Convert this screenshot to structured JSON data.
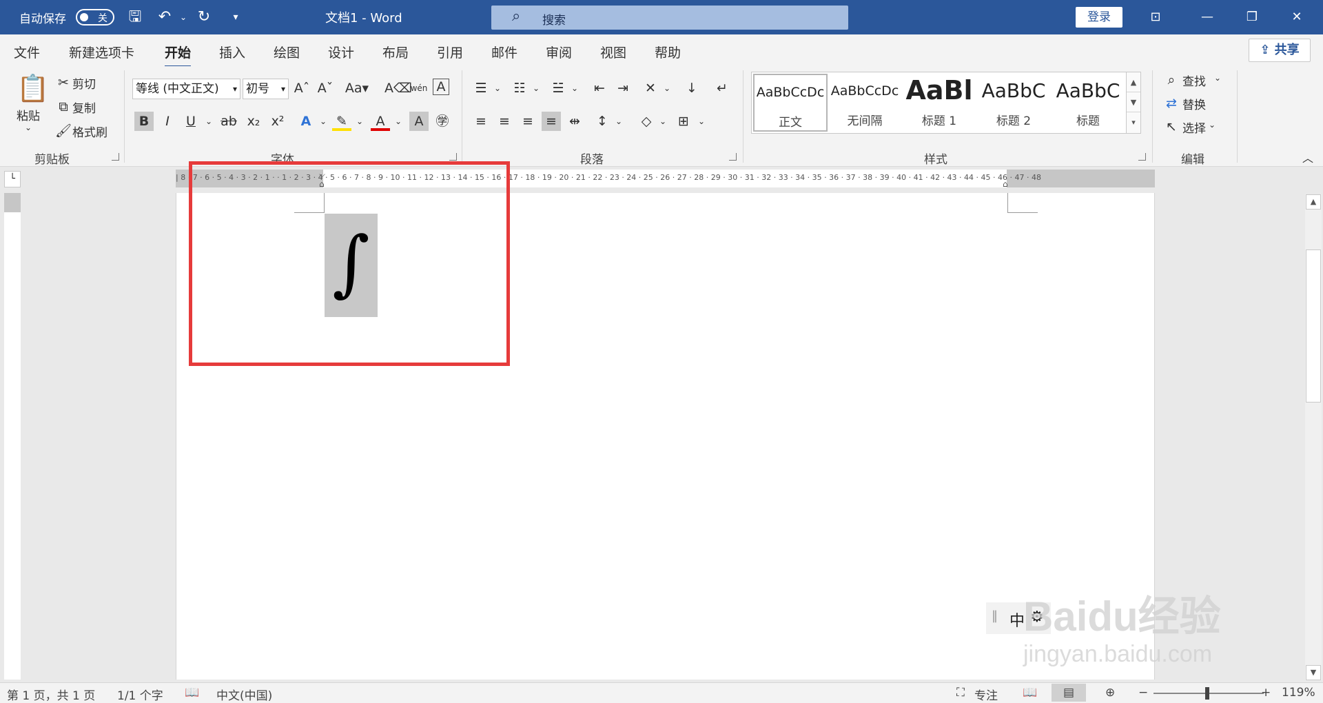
{
  "titlebar": {
    "autosave_label": "自动保存",
    "autosave_state": "关",
    "doc_title": "文档1  -  Word",
    "search_placeholder": "搜索",
    "login_label": "登录"
  },
  "menu": {
    "tabs": [
      "文件",
      "新建选项卡",
      "开始",
      "插入",
      "绘图",
      "设计",
      "布局",
      "引用",
      "邮件",
      "审阅",
      "视图",
      "帮助"
    ],
    "active_tab": "开始",
    "share_label": "共享"
  },
  "ribbon": {
    "clipboard": {
      "paste": "粘贴",
      "cut": "剪切",
      "copy": "复制",
      "format_painter": "格式刷",
      "group_label": "剪贴板"
    },
    "font": {
      "font_name": "等线 (中文正文)",
      "font_size": "初号",
      "group_label": "字体"
    },
    "paragraph": {
      "group_label": "段落"
    },
    "styles": {
      "items": [
        {
          "sample": "AaBbCcDc",
          "name": "正文"
        },
        {
          "sample": "AaBbCcDc",
          "name": "无间隔"
        },
        {
          "sample": "AaBl",
          "name": "标题 1"
        },
        {
          "sample": "AaBbC",
          "name": "标题 2"
        },
        {
          "sample": "AaBbC",
          "name": "标题"
        }
      ],
      "group_label": "样式"
    },
    "editing": {
      "find": "查找",
      "replace": "替换",
      "select": "选择",
      "group_label": "编辑"
    }
  },
  "ruler": {
    "marks": "| 8 · 7 · 6 · 5 · 4 · 3 · 2 · 1 ·   · 1 · 2 · 3 · 4 · 5 · 6 · 7 · 8 · 9 · 10 · 11 · 12 · 13 · 14 · 15 · 16 · 17 · 18 · 19 · 20 · 21 · 22 · 23 · 24 · 25 · 26 · 27 · 28 · 29 · 30 · 31 · 32 · 33 · 34 · 35 · 36 · 37 · 38 · 39 · 40 · 41 · 42 · 43 · 44 · 45 · 46 · 47 · 48"
  },
  "document": {
    "symbol": "∫"
  },
  "ime": {
    "mode": "中"
  },
  "watermark": {
    "brand": "Baidu经验",
    "url": "jingyan.baidu.com"
  },
  "statusbar": {
    "page": "第 1 页，共 1 页",
    "words": "1/1 个字",
    "language": "中文(中国)",
    "focus": "专注",
    "zoom": "119%"
  }
}
